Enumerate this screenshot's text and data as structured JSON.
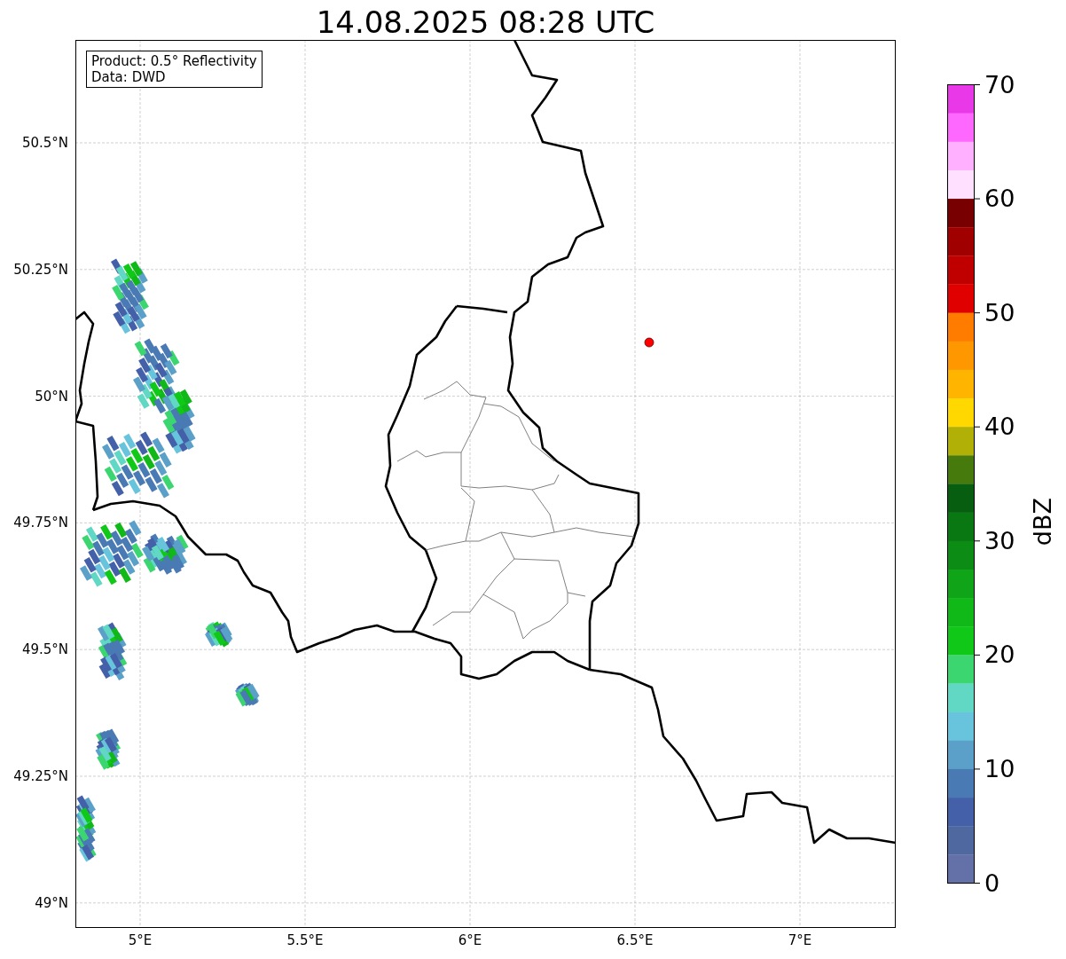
{
  "title": "14.08.2025 08:28 UTC",
  "info_box": {
    "lines": [
      "Product: 0.5° Reflectivity",
      "Data: DWD"
    ]
  },
  "map": {
    "lat_ticks": [
      "50.5°N",
      "50.25°N",
      "50°N",
      "49.75°N",
      "49.5°N",
      "49.25°N",
      "49°N"
    ],
    "lon_ticks": [
      "5°E",
      "5.5°E",
      "6°E",
      "6.5°E",
      "7°E"
    ]
  },
  "colorbar": {
    "label": "dBZ",
    "ticks": [
      "70",
      "60",
      "50",
      "40",
      "30",
      "20",
      "10",
      "0"
    ],
    "bins": [
      {
        "color": "#e838e8"
      },
      {
        "color": "#ff68ff"
      },
      {
        "color": "#ffb0ff"
      },
      {
        "color": "#ffe0ff"
      },
      {
        "color": "#780000"
      },
      {
        "color": "#a00000"
      },
      {
        "color": "#c00000"
      },
      {
        "color": "#e00000"
      },
      {
        "color": "#ff7c00"
      },
      {
        "color": "#ff9800"
      },
      {
        "color": "#ffb400"
      },
      {
        "color": "#ffd800"
      },
      {
        "color": "#b0b006"
      },
      {
        "color": "#467a0c"
      },
      {
        "color": "#085e10"
      },
      {
        "color": "#0a7812"
      },
      {
        "color": "#0c8c14"
      },
      {
        "color": "#10a418"
      },
      {
        "color": "#10b818"
      },
      {
        "color": "#10c818"
      },
      {
        "color": "#3cd670"
      },
      {
        "color": "#60d8c4"
      },
      {
        "color": "#68c4dc"
      },
      {
        "color": "#5aa0c8"
      },
      {
        "color": "#4a7ab4"
      },
      {
        "color": "#4460a8"
      },
      {
        "color": "#5068a0"
      },
      {
        "color": "#6470a8"
      }
    ]
  }
}
